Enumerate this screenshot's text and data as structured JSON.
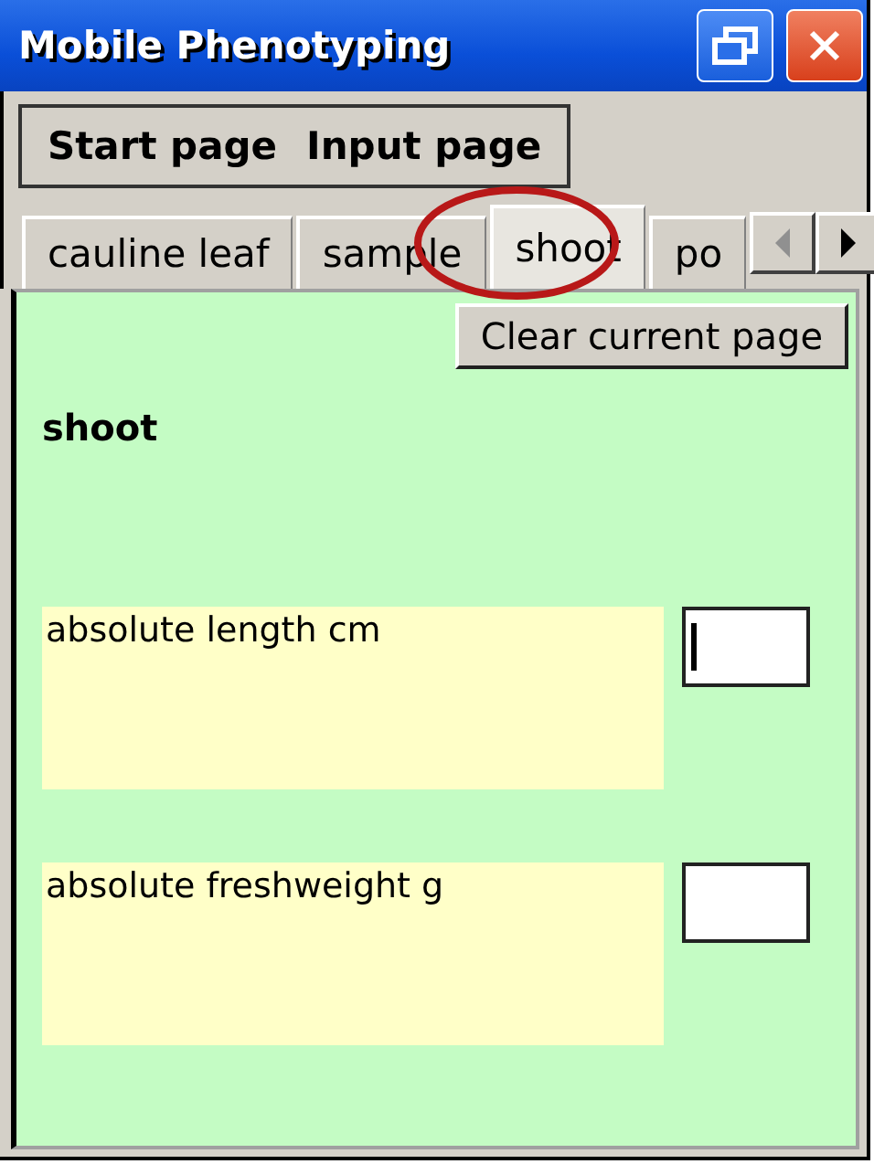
{
  "window": {
    "title": "Mobile Phenotyping"
  },
  "menu": [
    {
      "label": "Start page"
    },
    {
      "label": "Input page"
    }
  ],
  "tabs": [
    {
      "label": "cauline leaf",
      "selected": false
    },
    {
      "label": "sample",
      "selected": false
    },
    {
      "label": "shoot",
      "selected": true
    },
    {
      "label": "po",
      "selected": false
    }
  ],
  "tab_scroll": {
    "left_disabled": true,
    "right_disabled": false
  },
  "clear_button": "Clear current page",
  "heading": "shoot",
  "fields": [
    {
      "label": "absolute length cm",
      "focused": true
    },
    {
      "label": "absolute freshweight g",
      "focused": false
    }
  ]
}
